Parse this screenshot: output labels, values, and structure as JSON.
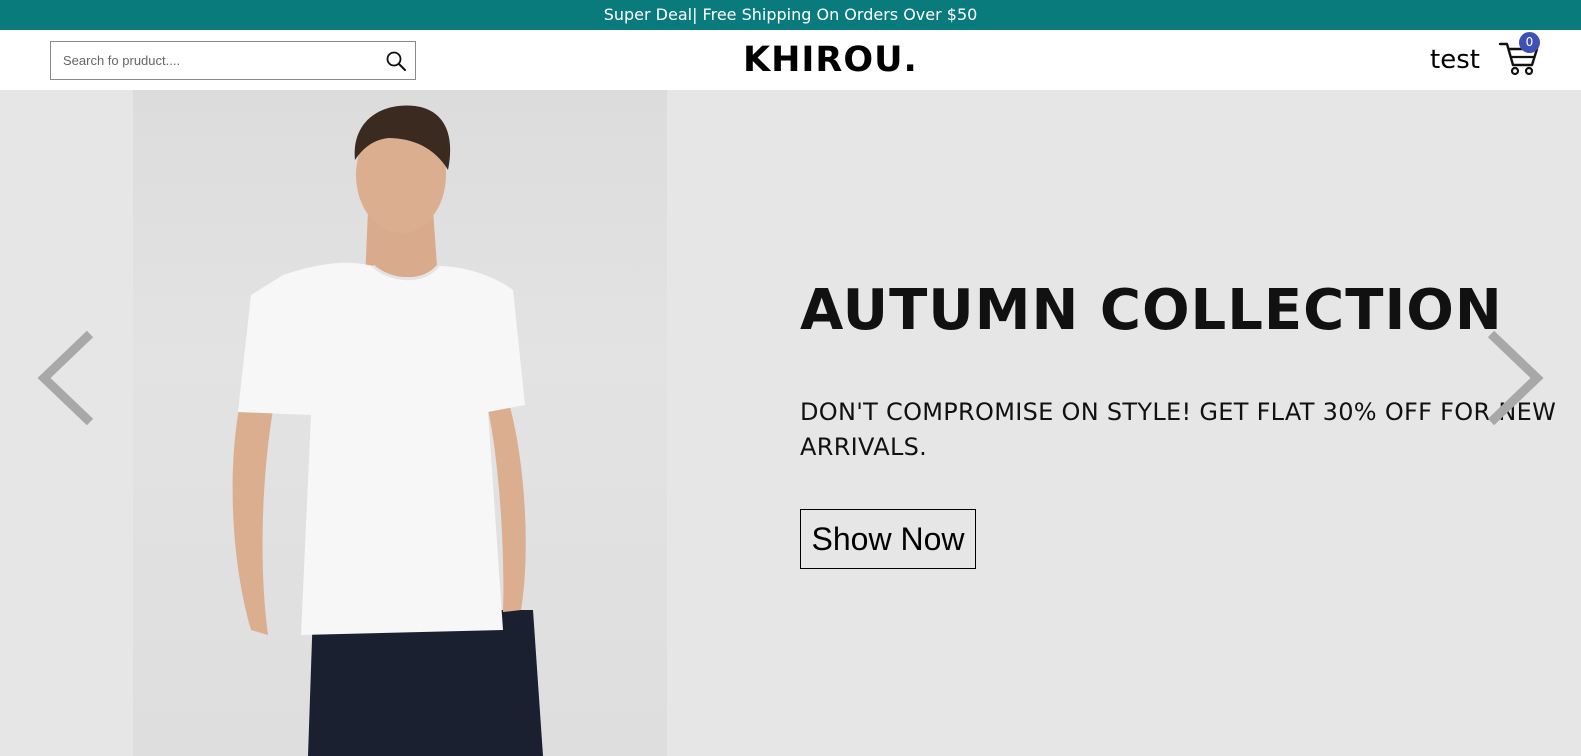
{
  "promo": {
    "text": "Super Deal| Free Shipping On Orders Over $50"
  },
  "header": {
    "search": {
      "placeholder": "Search fo pruduct....",
      "icon": "search-icon"
    },
    "logo": "KHIROU.",
    "user_name": "test",
    "cart": {
      "icon": "cart-icon",
      "count": "0"
    }
  },
  "hero": {
    "title": "AUTUMN COLLECTION",
    "description": "DON'T COMPROMISE ON STYLE! GET FLAT 30% OFF FOR NEW ARRIVALS.",
    "cta_label": "Show Now",
    "prev_icon": "chevron-left-icon",
    "next_icon": "chevron-right-icon"
  },
  "colors": {
    "promo_bg": "#0a7b7d",
    "hero_bg": "#e6e6e6",
    "badge_bg": "#3f51b5",
    "arrow": "#a8a8a8"
  }
}
